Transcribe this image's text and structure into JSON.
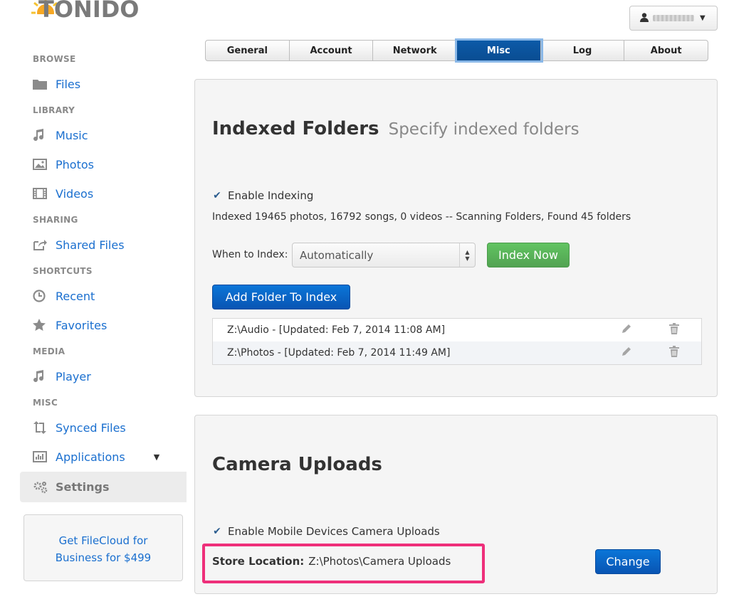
{
  "app": {
    "logo_text": "TONIDO"
  },
  "user_menu": {
    "icon": "user-icon"
  },
  "sidebar": {
    "sections": [
      {
        "key": "browse",
        "label": "BROWSE"
      },
      {
        "key": "library",
        "label": "LIBRARY"
      },
      {
        "key": "sharing",
        "label": "SHARING"
      },
      {
        "key": "shortcuts",
        "label": "SHORTCUTS"
      },
      {
        "key": "media",
        "label": "MEDIA"
      },
      {
        "key": "misc",
        "label": "MISC"
      }
    ],
    "items": [
      {
        "label": "Files",
        "icon": "folder-icon"
      },
      {
        "label": "Music",
        "icon": "music-note-icon"
      },
      {
        "label": "Photos",
        "icon": "picture-icon"
      },
      {
        "label": "Videos",
        "icon": "film-icon"
      },
      {
        "label": "Shared Files",
        "icon": "share-icon"
      },
      {
        "label": "Recent",
        "icon": "clock-icon"
      },
      {
        "label": "Favorites",
        "icon": "star-icon"
      },
      {
        "label": "Player",
        "icon": "music-note-icon"
      },
      {
        "label": "Synced Files",
        "icon": "sync-icon"
      },
      {
        "label": "Applications",
        "icon": "bar-chart-icon"
      },
      {
        "label": "Settings",
        "icon": "gears-icon"
      }
    ],
    "promo_line1": "Get FileCloud for",
    "promo_line2": "Business for $499"
  },
  "tabs": [
    {
      "label": "General",
      "active": false
    },
    {
      "label": "Account",
      "active": false
    },
    {
      "label": "Network",
      "active": false
    },
    {
      "label": "Misc",
      "active": true
    },
    {
      "label": "Log",
      "active": false
    },
    {
      "label": "About",
      "active": false
    }
  ],
  "indexed": {
    "title": "Indexed Folders",
    "subtitle": "Specify indexed folders",
    "enable_label": "Enable Indexing",
    "enable_checked": true,
    "status": "Indexed 19465 photos, 16792 songs, 0 videos -- Scanning Folders, Found 45 folders",
    "when_label": "When to Index:",
    "when_value": "Automatically",
    "index_now_label": "Index Now",
    "add_folder_label": "Add Folder To Index",
    "folders": [
      "Z:\\Audio - [Updated: Feb 7, 2014 11:08 AM]",
      "Z:\\Photos - [Updated: Feb 7, 2014 11:49 AM]"
    ]
  },
  "camera": {
    "title": "Camera Uploads",
    "enable_label": "Enable Mobile Devices Camera Uploads",
    "enable_checked": true,
    "store_label": "Store Location:",
    "store_value": "Z:\\Photos\\Camera Uploads",
    "change_label": "Change"
  },
  "colors": {
    "accent": "#1a6fcf",
    "highlight": "#ee2f7a",
    "active_tab": "#0b55a0",
    "green": "#5bb75b"
  }
}
